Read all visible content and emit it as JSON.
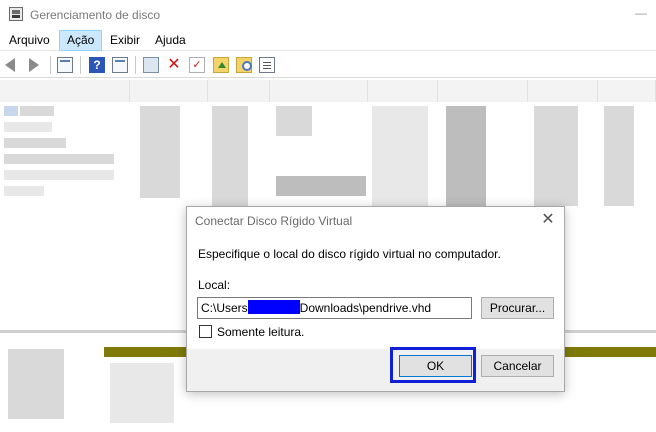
{
  "window": {
    "title": "Gerenciamento de disco",
    "minimize_glyph": "—"
  },
  "menu": {
    "items": [
      "Arquivo",
      "Ação",
      "Exibir",
      "Ajuda"
    ],
    "active": "Ação"
  },
  "toolbar": {
    "icons": [
      "back-arrow-icon",
      "forward-arrow-icon",
      "properties-icon",
      "help-icon",
      "view-icon",
      "connect-icon",
      "delete-icon",
      "check-icon",
      "folder-up-icon",
      "folder-search-icon",
      "list-icon"
    ],
    "help_glyph": "?",
    "delete_glyph": "✕",
    "check_glyph": "✓"
  },
  "dialog": {
    "title": "Conectar Disco Rígido Virtual",
    "close_glyph": "✕",
    "description": "Especifique o local do disco rígido virtual no computador.",
    "location_label": "Local:",
    "path_prefix": "C:\\Users",
    "path_suffix": "Downloads\\pendrive.vhd",
    "browse_button": "Procurar...",
    "readonly_label": "Somente leitura.",
    "readonly_checked": false,
    "ok_button": "OK",
    "cancel_button": "Cancelar"
  },
  "colors": {
    "menu_active_bg": "#cce8ff",
    "redaction": "#0000ff",
    "ok_highlight": "#1020d8",
    "disk_strip": "#7f7a08"
  }
}
